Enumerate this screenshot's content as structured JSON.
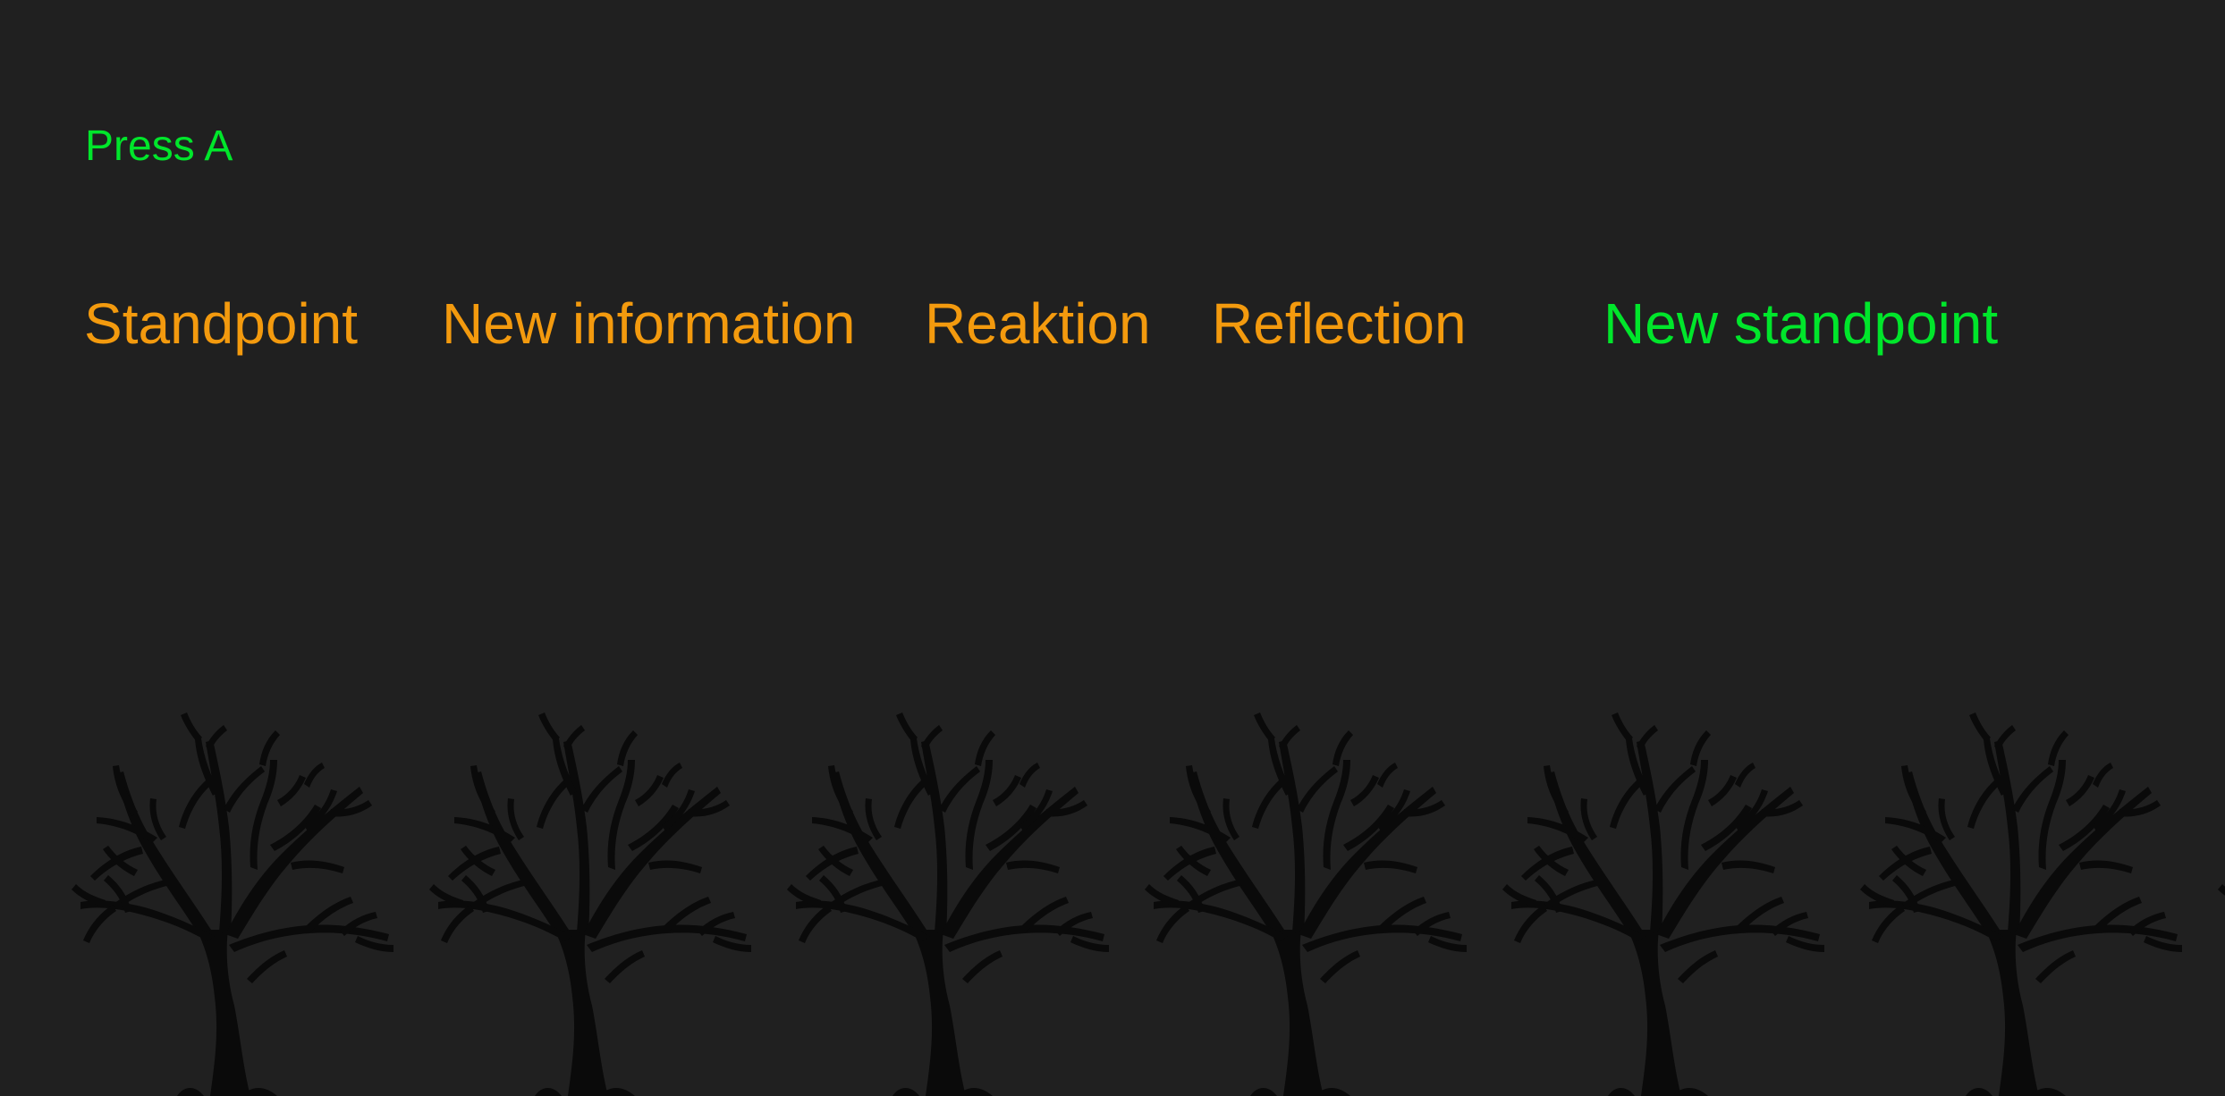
{
  "prompt": {
    "text": "Press A",
    "color": "#00e62b"
  },
  "steps": [
    {
      "label": "Standpoint",
      "color": "#f39a0e",
      "state": "done"
    },
    {
      "label": "New information",
      "color": "#f39a0e",
      "state": "done"
    },
    {
      "label": "Reaktion",
      "color": "#f39a0e",
      "state": "done"
    },
    {
      "label": "Reflection",
      "color": "#f39a0e",
      "state": "done"
    },
    {
      "label": "New standpoint",
      "color": "#00e62b",
      "state": "current"
    }
  ],
  "colors": {
    "background": "#202020",
    "tree": "#0a0a0a",
    "done": "#f39a0e",
    "current": "#00e62b"
  },
  "trees": {
    "count": 7,
    "icon": "bare-tree-icon"
  }
}
